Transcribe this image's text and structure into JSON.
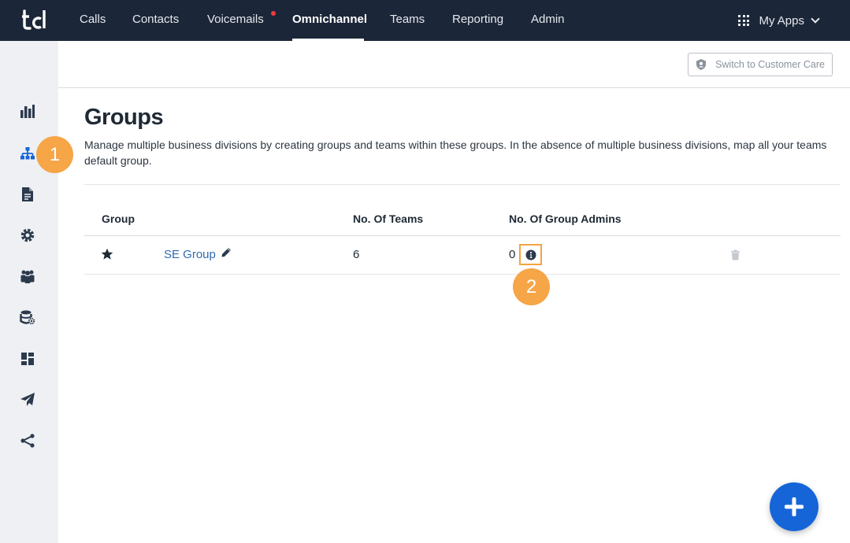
{
  "topnav": {
    "items": [
      {
        "label": "Calls"
      },
      {
        "label": "Contacts"
      },
      {
        "label": "Voicemails"
      },
      {
        "label": "Omnichannel"
      },
      {
        "label": "Teams"
      },
      {
        "label": "Reporting"
      },
      {
        "label": "Admin"
      }
    ],
    "active": "Omnichannel",
    "my_apps_label": "My Apps"
  },
  "header": {
    "switch_button_label": "Switch to Customer Care"
  },
  "page": {
    "title": "Groups",
    "description_line1": "Manage multiple business divisions by creating groups and teams within these groups. In the absence of multiple business divisions, map all your teams",
    "description_line2": "default group."
  },
  "table": {
    "headers": {
      "group": "Group",
      "teams": "No. Of Teams",
      "admins": "No. Of Group Admins"
    },
    "rows": [
      {
        "name": "SE Group",
        "teams": "6",
        "admins": "0"
      }
    ]
  },
  "callouts": {
    "one": "1",
    "two": "2"
  },
  "colors": {
    "topbar": "#1b2638",
    "accent": "#1565d8",
    "callout": "#f6a547",
    "link": "#2f6bb1"
  },
  "icons": {
    "sidebar": [
      "bar-chart-icon",
      "org-chart-icon",
      "document-icon",
      "gear-icon",
      "people-icon",
      "database-settings-icon",
      "dashboard-icon",
      "paper-plane-icon",
      "share-icon"
    ]
  }
}
